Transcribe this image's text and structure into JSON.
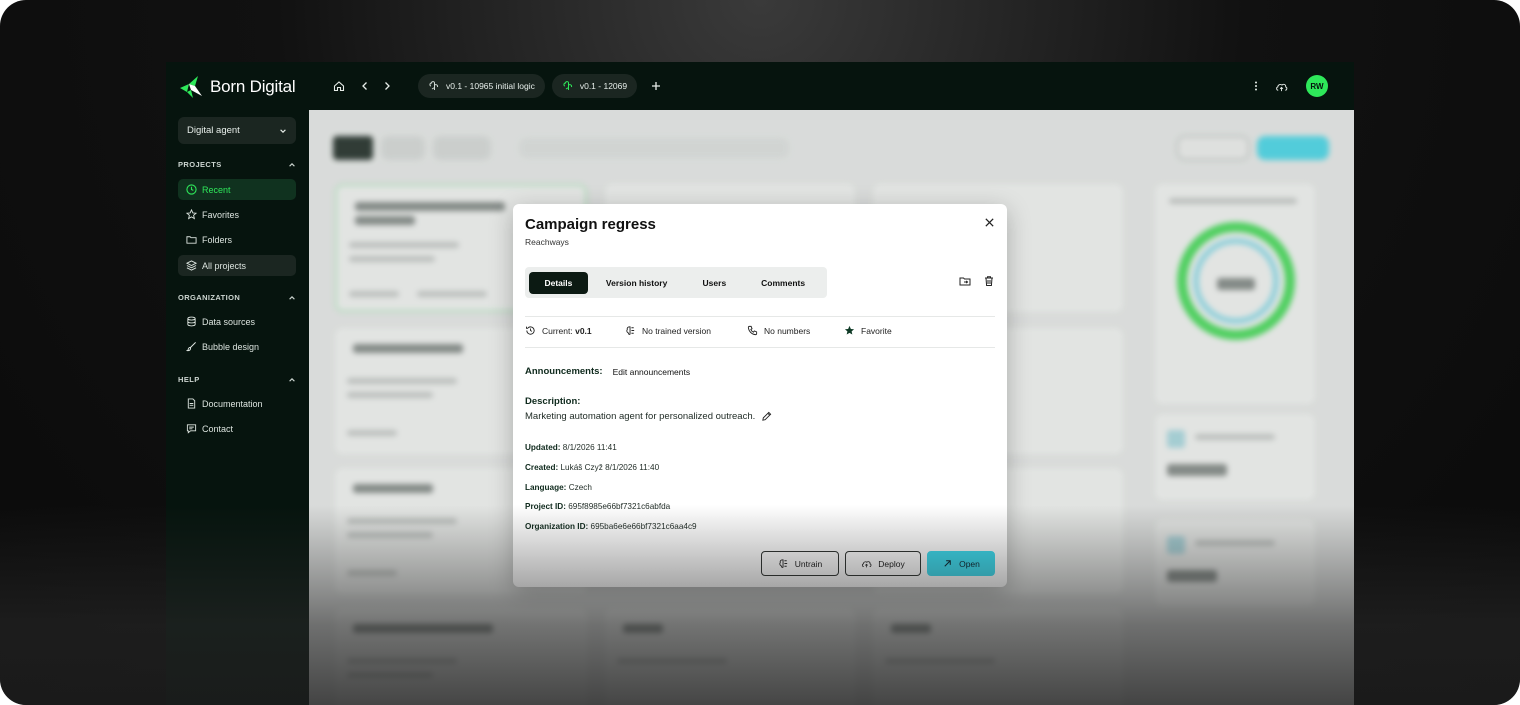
{
  "brand": {
    "name": "Born Digital",
    "accent": "#2ee85a",
    "cyan": "#39dcf0",
    "dark": "#06140e"
  },
  "sidebar": {
    "agent_select": "Digital agent",
    "sections": [
      {
        "title": "PROJECTS",
        "items": [
          {
            "label": "Recent",
            "icon": "clock-icon"
          },
          {
            "label": "Favorites",
            "icon": "star-icon"
          },
          {
            "label": "Folders",
            "icon": "folder-icon"
          },
          {
            "label": "All projects",
            "icon": "layers-icon"
          }
        ]
      },
      {
        "title": "ORGANIZATION",
        "items": [
          {
            "label": "Data sources",
            "icon": "database-icon"
          },
          {
            "label": "Bubble design",
            "icon": "brush-icon"
          }
        ]
      },
      {
        "title": "HELP",
        "items": [
          {
            "label": "Documentation",
            "icon": "document-icon"
          },
          {
            "label": "Contact",
            "icon": "chat-icon"
          }
        ]
      }
    ]
  },
  "topbar": {
    "tabs": [
      {
        "label": "v0.1 - 10965 initial logic"
      },
      {
        "label": "v0.1 - 12069"
      }
    ],
    "avatar": "RW"
  },
  "modal": {
    "title": "Campaign regress",
    "subtitle": "Reachways",
    "tabs": [
      "Details",
      "Version history",
      "Users",
      "Comments"
    ],
    "meta": {
      "current_label": "Current:",
      "current_value": "v0.1",
      "trained": "No trained version",
      "numbers": "No numbers",
      "favorite": "Favorite"
    },
    "announcements_label": "Announcements:",
    "announcements_value": "Edit announcements",
    "description_label": "Description:",
    "description_value": "Marketing automation agent for personalized outreach.",
    "fields": [
      {
        "label": "Updated:",
        "value": "8/1/2026 11:41"
      },
      {
        "label": "Created:",
        "value": "Lukáš Czyž 8/1/2026 11:40"
      },
      {
        "label": "Language:",
        "value": "Czech"
      },
      {
        "label": "Project ID:",
        "value": "695f8985e66bf7321c6abfda"
      },
      {
        "label": "Organization ID:",
        "value": "695ba6e6e66bf7321c6aa4c9"
      }
    ],
    "buttons": {
      "untrain": "Untrain",
      "deploy": "Deploy",
      "open": "Open"
    }
  }
}
